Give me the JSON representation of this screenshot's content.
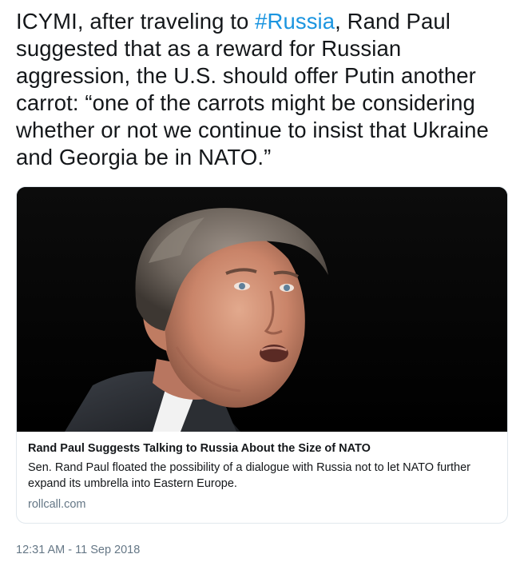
{
  "tweet": {
    "text_before": "ICYMI, after traveling to ",
    "hashtag": "#Russia",
    "text_after": ", Rand Paul suggested that as a reward for Russian aggression, the U.S. should offer Putin another carrot: “one of the carrots might be considering whether or not we continue to insist that Ukraine and Georgia be in NATO.”"
  },
  "card": {
    "image_icon": "portrait-photo",
    "title": "Rand Paul Suggests Talking to Russia About the Size of NATO",
    "description": "Sen. Rand Paul floated the possibility of a dialogue with Russia not to let NATO further expand its umbrella into Eastern Europe.",
    "domain": "rollcall.com"
  },
  "timestamp": "12:31 AM - 11 Sep 2018",
  "colors": {
    "hashtag": "#1b95e0",
    "secondary_text": "#657786",
    "card_border": "#e1e8ed"
  }
}
